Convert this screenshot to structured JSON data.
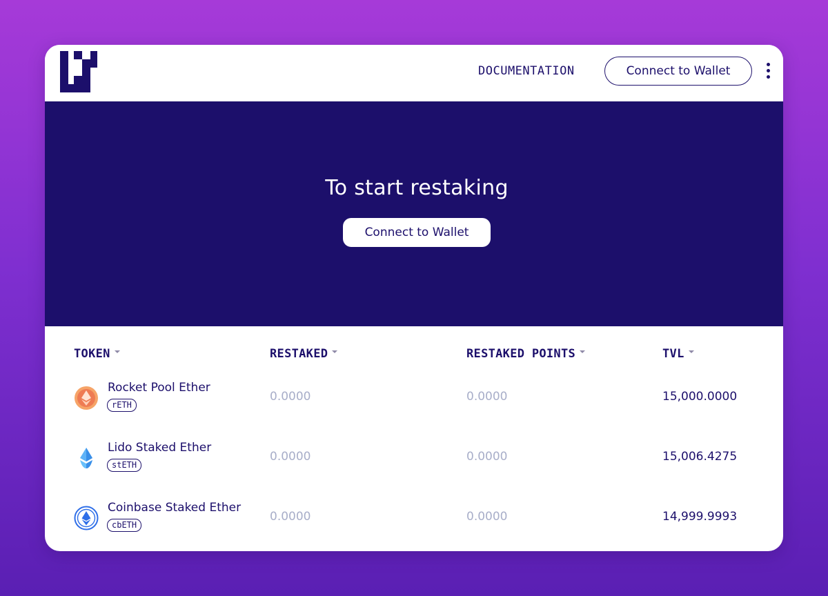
{
  "header": {
    "documentation_label": "DOCUMENTATION",
    "connect_label": "Connect to Wallet",
    "menu_icon": "kebab-menu-icon"
  },
  "hero": {
    "title": "To start restaking",
    "connect_label": "Connect to Wallet"
  },
  "colors": {
    "brand": "#1c0f6b",
    "background_gradient": [
      "#a63ad8",
      "#5a1fb3"
    ],
    "muted_value": "#a8aec9"
  },
  "table": {
    "columns": [
      "TOKEN",
      "RESTAKED",
      "RESTAKED POINTS",
      "TVL"
    ],
    "rows": [
      {
        "name": "Rocket Pool Ether",
        "symbol": "rETH",
        "icon": "reth-token-icon",
        "restaked": "0.0000",
        "restaked_points": "0.0000",
        "tvl": "15,000.0000"
      },
      {
        "name": "Lido Staked Ether",
        "symbol": "stETH",
        "icon": "steth-token-icon",
        "restaked": "0.0000",
        "restaked_points": "0.0000",
        "tvl": "15,006.4275"
      },
      {
        "name": "Coinbase Staked Ether",
        "symbol": "cbETH",
        "icon": "cbeth-token-icon",
        "restaked": "0.0000",
        "restaked_points": "0.0000",
        "tvl": "14,999.9993"
      }
    ]
  }
}
